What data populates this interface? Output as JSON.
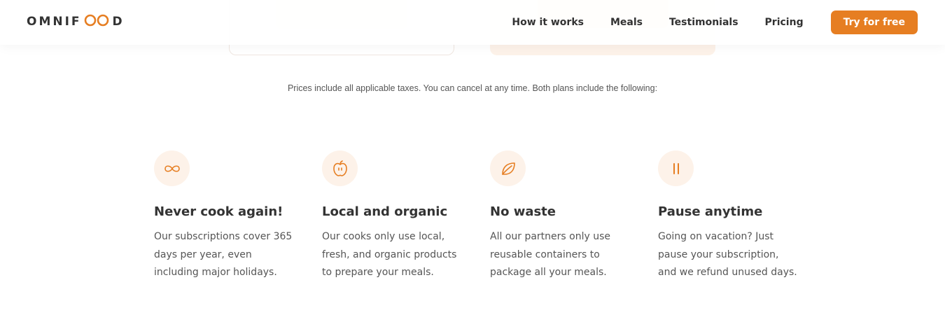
{
  "header": {
    "logo_text_left": "OMNIF",
    "logo_text_right": "D",
    "nav": {
      "how_it_works": "How it works",
      "meals": "Meals",
      "testimonials": "Testimonials",
      "pricing": "Pricing",
      "cta": "Try for free"
    }
  },
  "pricing": {
    "note": "Prices include all applicable taxes. You can cancel at any time. Both plans include the following:"
  },
  "features": [
    {
      "icon": "infinity-icon",
      "title": "Never cook again!",
      "text": "Our subscriptions cover 365 days per year, even including major holidays."
    },
    {
      "icon": "apple-icon",
      "title": "Local and organic",
      "text": "Our cooks only use local, fresh, and organic products to prepare your meals."
    },
    {
      "icon": "leaf-icon",
      "title": "No waste",
      "text": "All our partners only use reusable containers to package all your meals."
    },
    {
      "icon": "pause-icon",
      "title": "Pause anytime",
      "text": "Going on vacation? Just pause your subscription, and we refund unused days."
    }
  ],
  "colors": {
    "accent": "#e67e22",
    "accent_tint": "#fdf2e9",
    "heading": "#333333",
    "body": "#555555"
  }
}
